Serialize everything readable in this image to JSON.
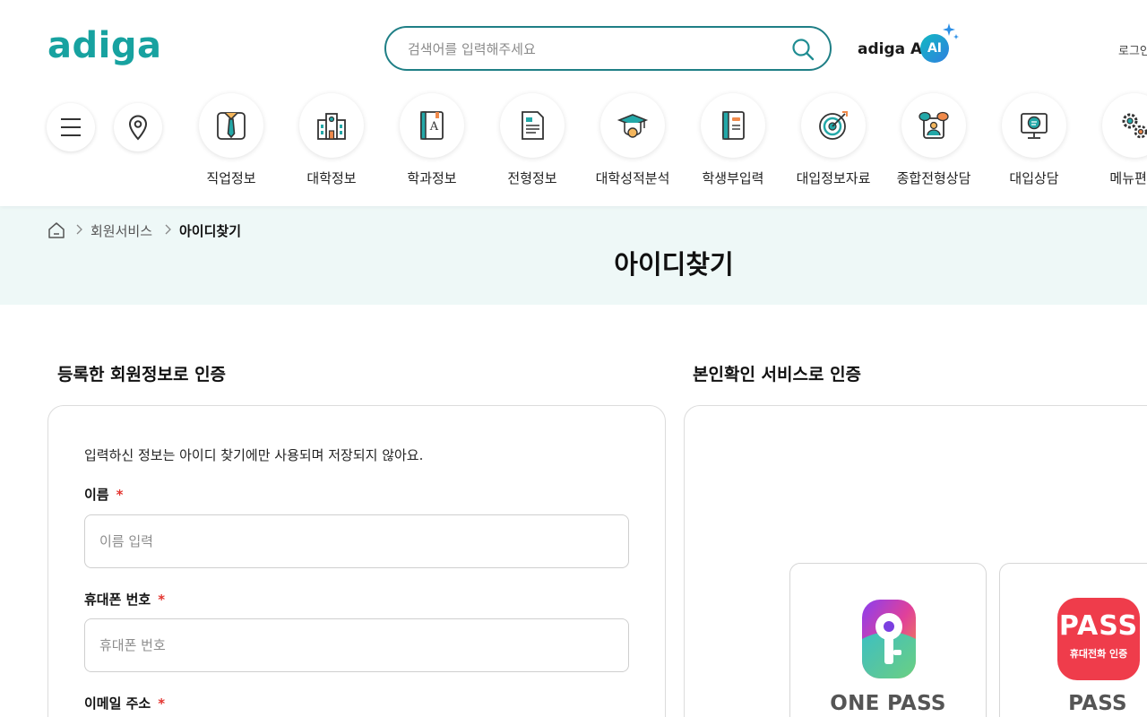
{
  "header": {
    "logo": "adiga",
    "search_placeholder": "검색어를 입력해주세요",
    "ai_label": "adiga AI",
    "ai_badge": "AI",
    "login": "로그인"
  },
  "nav": {
    "items": [
      {
        "label": "직업정보",
        "icon": "necktie-icon"
      },
      {
        "label": "대학정보",
        "icon": "university-building-icon"
      },
      {
        "label": "학과정보",
        "icon": "book-icon"
      },
      {
        "label": "전형정보",
        "icon": "document-icon"
      },
      {
        "label": "대학성적분석",
        "icon": "graduation-cap-icon"
      },
      {
        "label": "학생부입력",
        "icon": "notebook-icon"
      },
      {
        "label": "대입정보자료",
        "icon": "target-icon"
      },
      {
        "label": "종합전형상담",
        "icon": "consulting-icon"
      },
      {
        "label": "대입상담",
        "icon": "monitor-chat-icon"
      },
      {
        "label": "메뉴편집",
        "icon": "gears-icon"
      }
    ]
  },
  "breadcrumb": {
    "parent": "회원서비스",
    "current": "아이디찾기"
  },
  "page_title": "아이디찾기",
  "left_section": {
    "title": "등록한 회원정보로 인증",
    "notice": "입력하신 정보는 아이디 찾기에만 사용되며 저장되지 않아요.",
    "fields": [
      {
        "label": "이름",
        "placeholder": "이름 입력"
      },
      {
        "label": "휴대폰 번호",
        "placeholder": "휴대폰 번호"
      },
      {
        "label": "이메일 주소",
        "placeholder": ""
      }
    ],
    "required_mark": "*"
  },
  "right_section": {
    "title": "본인확인 서비스로 인증",
    "options": [
      {
        "name": "ONE PASS",
        "icon": "onepass-key-icon"
      },
      {
        "name": "PASS",
        "logo_text": "PASS",
        "logo_sub": "휴대전화 인증",
        "icon": "pass-logo-icon"
      }
    ]
  },
  "colors": {
    "brand": "#17a2a0",
    "search_border": "#1f7f86",
    "band_bg": "#eef8f7",
    "required": "#e3342f",
    "pass_red": "#ef3c4b"
  }
}
